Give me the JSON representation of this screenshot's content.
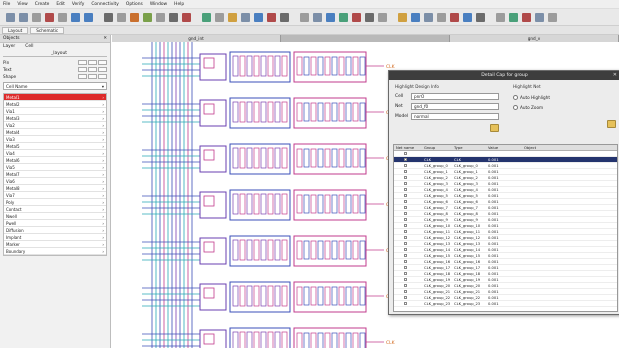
{
  "menu": {
    "items": [
      "File",
      "View",
      "Create",
      "Edit",
      "Verify",
      "Connectivity",
      "Options",
      "Window",
      "Help"
    ]
  },
  "toolbar": {
    "colors": [
      "#7c8fa8",
      "#7c8fa8",
      "#9c9c9c",
      "#b04a4a",
      "#9c9c9c",
      "#4a7fc0",
      "#4a7fc0",
      "#6b6b6b",
      "#9c9c9c",
      "#c9702e",
      "#7aa04a",
      "#9c9c9c",
      "#6b6b6b",
      "#b04a4a",
      "#4aa07a",
      "#9c9c9c",
      "#d0a040",
      "#7c8fa8",
      "#4a7fc0",
      "#b04a4a",
      "#6b6b6b",
      "#9c9c9c",
      "#7c8fa8",
      "#4a7fc0",
      "#4aa07a",
      "#b04a4a",
      "#6b6b6b",
      "#9c9c9c",
      "#d0a040",
      "#4a7fc0",
      "#7c8fa8",
      "#9c9c9c",
      "#b04a4a",
      "#4a7fc0",
      "#6b6b6b",
      "#9c9c9c",
      "#4aa07a",
      "#b04a4a",
      "#7c8fa8",
      "#9c9c9c"
    ]
  },
  "tabs": {
    "items": [
      "Layout",
      "Schematic"
    ]
  },
  "left_panel": {
    "title": "Objects",
    "subtitle_a": "Layer",
    "subtitle_b": "Cell",
    "field": "_layout",
    "rows": [
      {
        "name": "Pin"
      },
      {
        "name": "Text"
      },
      {
        "name": "Shape"
      }
    ],
    "select": "Cell Name",
    "items": [
      "Metal1",
      "Metal2",
      "Via1",
      "Metal3",
      "Via2",
      "Metal4",
      "Via3",
      "Metal5",
      "Via4",
      "Metal6",
      "Via5",
      "Metal7",
      "Via6",
      "Metal8",
      "Via7",
      "Poly",
      "Contact",
      "Nwell",
      "Pwell",
      "Diffusion",
      "Implant",
      "Marker",
      "Boundary"
    ]
  },
  "canvas": {
    "tabs": [
      "gnd_int",
      "",
      "gnd_v"
    ],
    "label": "CLK"
  },
  "dialog": {
    "title": "Detail Cap for group",
    "sec_left": "Highlight Design Info",
    "sec_right": "Highlight Net",
    "lbl_cell": "Cell",
    "lbl_net": "Net",
    "lbl_model": "Model",
    "val_cell": "pnrO",
    "val_net": "gnd_f0",
    "val_model": "normal",
    "radio_a": "Auto Highlight",
    "radio_b": "Auto Zoom",
    "columns": [
      "Net name",
      "Group",
      "Type",
      "Value",
      "Object"
    ],
    "rows": [
      {
        "net": "",
        "group": "",
        "type": "",
        "value": "",
        "object": ""
      },
      {
        "net": "",
        "group": "CLK",
        "type": "CLK",
        "value": "0.001",
        "object": ""
      },
      {
        "net": "",
        "group": "CLK_group_0",
        "type": "CLK_group_0",
        "value": "0.001",
        "object": ""
      },
      {
        "net": "",
        "group": "CLK_group_1",
        "type": "CLK_group_1",
        "value": "0.001",
        "object": ""
      },
      {
        "net": "",
        "group": "CLK_group_2",
        "type": "CLK_group_2",
        "value": "0.001",
        "object": ""
      },
      {
        "net": "",
        "group": "CLK_group_3",
        "type": "CLK_group_3",
        "value": "0.001",
        "object": ""
      },
      {
        "net": "",
        "group": "CLK_group_4",
        "type": "CLK_group_4",
        "value": "0.001",
        "object": ""
      },
      {
        "net": "",
        "group": "CLK_group_5",
        "type": "CLK_group_5",
        "value": "0.001",
        "object": ""
      },
      {
        "net": "",
        "group": "CLK_group_6",
        "type": "CLK_group_6",
        "value": "0.001",
        "object": ""
      },
      {
        "net": "",
        "group": "CLK_group_7",
        "type": "CLK_group_7",
        "value": "0.001",
        "object": ""
      },
      {
        "net": "",
        "group": "CLK_group_8",
        "type": "CLK_group_8",
        "value": "0.001",
        "object": ""
      },
      {
        "net": "",
        "group": "CLK_group_9",
        "type": "CLK_group_9",
        "value": "0.001",
        "object": ""
      },
      {
        "net": "",
        "group": "CLK_group_10",
        "type": "CLK_group_10",
        "value": "0.001",
        "object": ""
      },
      {
        "net": "",
        "group": "CLK_group_11",
        "type": "CLK_group_11",
        "value": "0.001",
        "object": ""
      },
      {
        "net": "",
        "group": "CLK_group_12",
        "type": "CLK_group_12",
        "value": "0.001",
        "object": ""
      },
      {
        "net": "",
        "group": "CLK_group_13",
        "type": "CLK_group_13",
        "value": "0.001",
        "object": ""
      },
      {
        "net": "",
        "group": "CLK_group_14",
        "type": "CLK_group_14",
        "value": "0.001",
        "object": ""
      },
      {
        "net": "",
        "group": "CLK_group_15",
        "type": "CLK_group_15",
        "value": "0.001",
        "object": ""
      },
      {
        "net": "",
        "group": "CLK_group_16",
        "type": "CLK_group_16",
        "value": "0.001",
        "object": ""
      },
      {
        "net": "",
        "group": "CLK_group_17",
        "type": "CLK_group_17",
        "value": "0.001",
        "object": ""
      },
      {
        "net": "",
        "group": "CLK_group_18",
        "type": "CLK_group_18",
        "value": "0.001",
        "object": ""
      },
      {
        "net": "",
        "group": "CLK_group_19",
        "type": "CLK_group_19",
        "value": "0.001",
        "object": ""
      },
      {
        "net": "",
        "group": "CLK_group_20",
        "type": "CLK_group_20",
        "value": "0.001",
        "object": ""
      },
      {
        "net": "",
        "group": "CLK_group_21",
        "type": "CLK_group_21",
        "value": "0.001",
        "object": ""
      },
      {
        "net": "",
        "group": "CLK_group_22",
        "type": "CLK_group_22",
        "value": "0.001",
        "object": ""
      },
      {
        "net": "",
        "group": "CLK_group_23",
        "type": "CLK_group_23",
        "value": "0.001",
        "object": ""
      }
    ]
  }
}
